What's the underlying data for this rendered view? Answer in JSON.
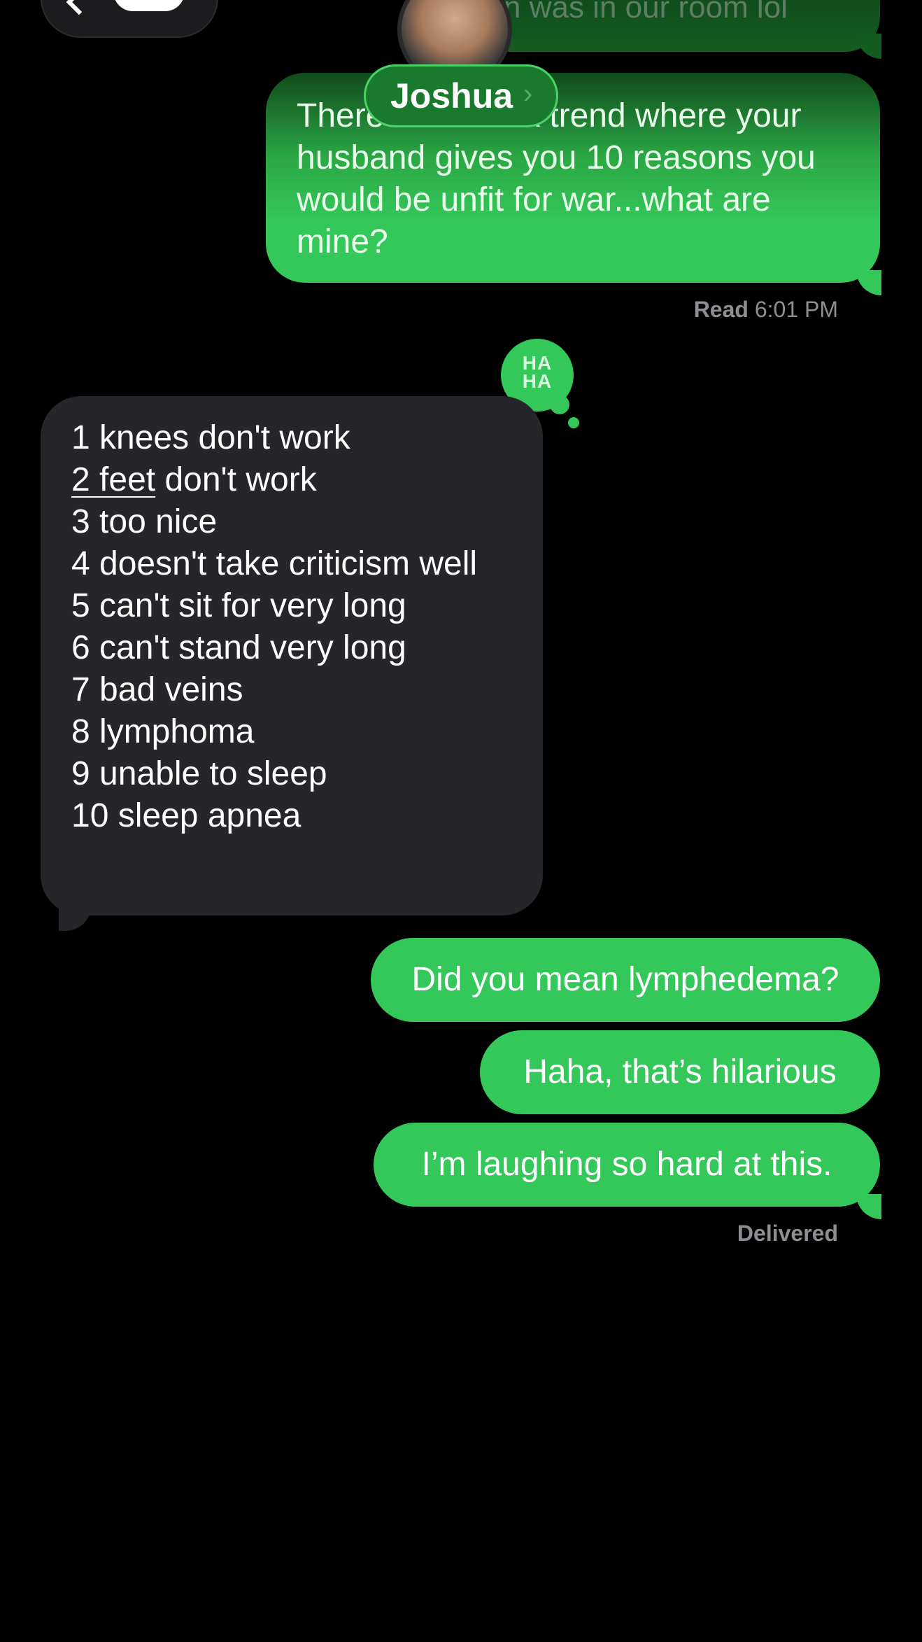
{
  "header": {
    "contact_name": "Joshua",
    "name_chevron": "›"
  },
  "messages": {
    "top_partial": "n was in our room lol",
    "question": "There's a TikTok trend where your husband gives you 10 reasons you would be unfit for war...what are mine?",
    "read_status": "Read",
    "read_time": "6:01 PM",
    "tapback": {
      "icon": "haha-icon",
      "line1": "HA",
      "line2": "HA"
    },
    "reply_list": [
      "1 knees don't work",
      "don't work",
      "3 too nice",
      "4 doesn't take criticism well",
      "5 can't sit for very long",
      "6 can't stand very long",
      "7 bad veins",
      "8 lymphoma",
      "9 unable to sleep",
      "10 sleep apnea"
    ],
    "reply_list_underlined": "2 feet",
    "sent": [
      "Did you mean lymphedema?",
      "Haha, that’s hilarious",
      "I’m laughing so hard at this."
    ],
    "delivered_status": "Delivered"
  },
  "colors": {
    "sent_bubble": "#34c759",
    "received_bubble": "#26262a",
    "background": "#000000",
    "status_text": "#8e8e93"
  }
}
